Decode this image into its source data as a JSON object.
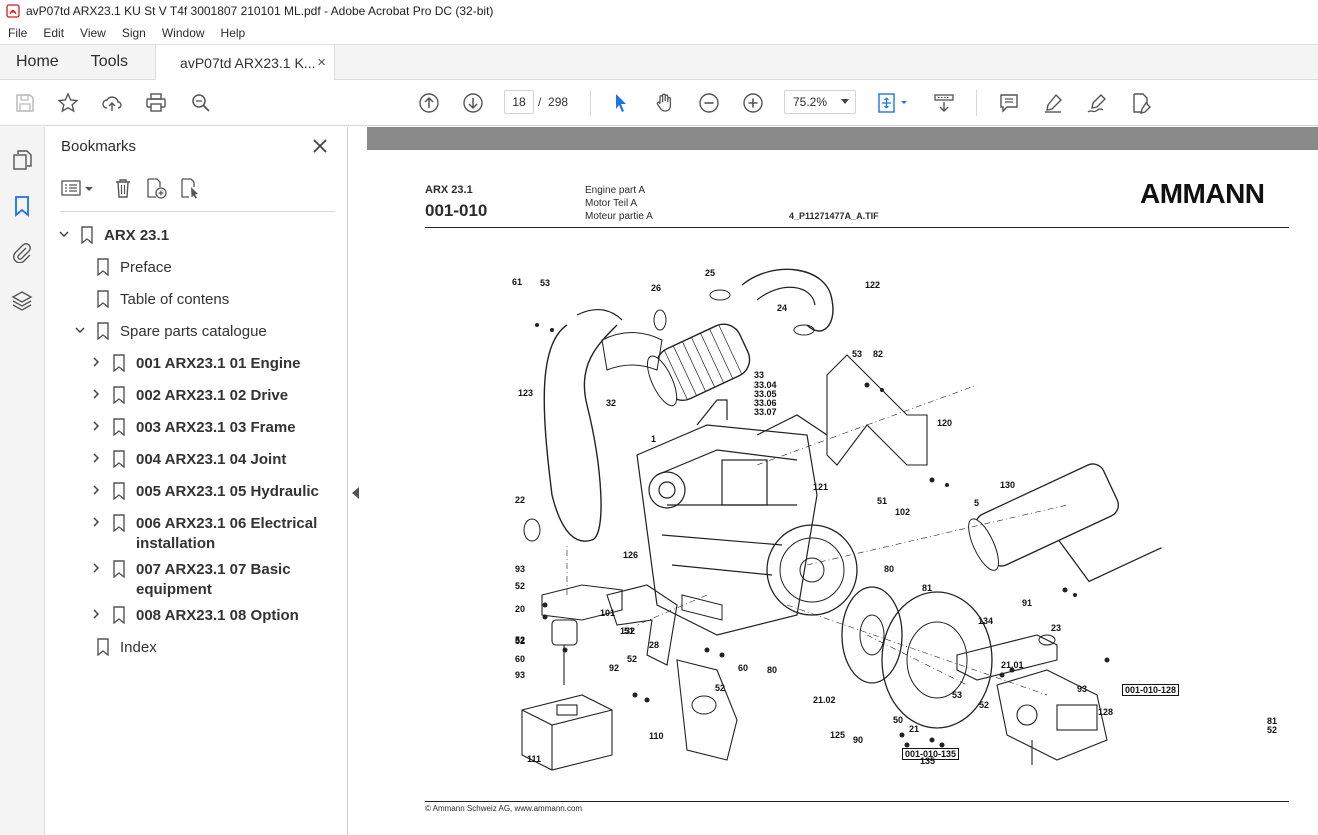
{
  "window": {
    "title": "avP07td ARX23.1 KU St V T4f 3001807 210101 ML.pdf - Adobe Acrobat Pro DC (32-bit)"
  },
  "menu": [
    "File",
    "Edit",
    "View",
    "Sign",
    "Window",
    "Help"
  ],
  "tabs": {
    "home": "Home",
    "tools": "Tools",
    "document": "avP07td ARX23.1 K...",
    "close": "×"
  },
  "toolbar": {
    "page_current": "18",
    "page_sep": "/",
    "page_total": "298",
    "zoom": "75.2%",
    "icons": [
      "save-icon",
      "star-icon",
      "upload-icon",
      "print-icon",
      "search-zoom-icon",
      "page-up-icon",
      "page-down-icon",
      "select-arrow-icon",
      "hand-icon",
      "zoom-out-icon",
      "zoom-in-icon",
      "fit-page-icon",
      "scroll-mode-icon",
      "comment-icon",
      "highlight-icon",
      "sign-icon",
      "edit-pdf-icon"
    ]
  },
  "rail": {
    "icons": [
      "pages-icon",
      "bookmark-icon",
      "attachment-icon",
      "layers-icon"
    ]
  },
  "bookmarks": {
    "title": "Bookmarks",
    "close": "×",
    "items": [
      {
        "label": "ARX 23.1",
        "level": 0,
        "expanded": true,
        "bold": true
      },
      {
        "label": "Preface",
        "level": 1
      },
      {
        "label": "Table of contens",
        "level": 1
      },
      {
        "label": "Spare parts catalogue",
        "level": 1,
        "expanded": true
      },
      {
        "label": "001 ARX23.1 01 Engine",
        "level": 2,
        "bold": true
      },
      {
        "label": "002 ARX23.1 02 Drive",
        "level": 2,
        "bold": true
      },
      {
        "label": "003 ARX23.1 03 Frame",
        "level": 2,
        "bold": true
      },
      {
        "label": "004 ARX23.1 04 Joint",
        "level": 2,
        "bold": true
      },
      {
        "label": "005 ARX23.1 05 Hydraulic",
        "level": 2,
        "bold": true
      },
      {
        "label": "006 ARX23.1 06 Electrical installation",
        "level": 2,
        "bold": true
      },
      {
        "label": "007 ARX23.1 07 Basic equipment",
        "level": 2,
        "bold": true
      },
      {
        "label": "008 ARX23.1 08 Option",
        "level": 2,
        "bold": true
      },
      {
        "label": "Index",
        "level": 1
      }
    ]
  },
  "document": {
    "machine": "ARX 23.1",
    "group": "001-010",
    "desc_en": "Engine part A",
    "desc_de": "Motor Teil A",
    "desc_fr": "Moteur partie A",
    "file": "4_P11271477A_A.TIF",
    "logo": "AMMANN",
    "footer": "© Ammann Schweiz AG, www.ammann.com",
    "callouts": [
      "61",
      "53",
      "26",
      "25",
      "24",
      "122",
      "123",
      "32",
      "33",
      "33.04",
      "33.05",
      "33.06",
      "33.07",
      "53",
      "82",
      "120",
      "1",
      "121",
      "51",
      "102",
      "22",
      "5",
      "130",
      "93",
      "52",
      "126",
      "80",
      "81",
      "20",
      "101",
      "51",
      "132",
      "52",
      "91",
      "134",
      "23",
      "52",
      "60",
      "93",
      "92",
      "52",
      "28",
      "60",
      "52",
      "21.01",
      "80",
      "53",
      "52",
      "93",
      "001-010-128",
      "128",
      "125",
      "50",
      "110",
      "21",
      "21.02",
      "81",
      "52",
      "90",
      "001-010-135",
      "135",
      "111"
    ]
  }
}
